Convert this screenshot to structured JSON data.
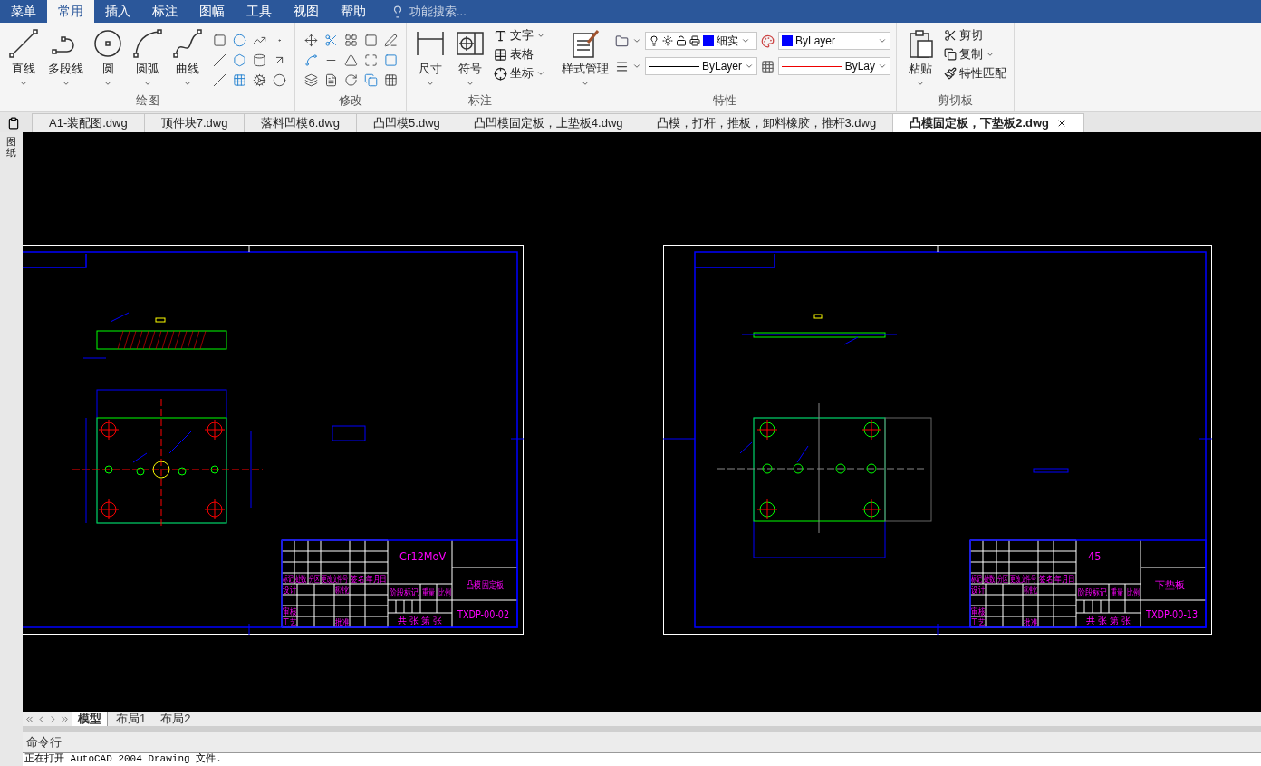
{
  "menu_tabs": [
    {
      "label": "菜单",
      "selected": false
    },
    {
      "label": "常用",
      "selected": true
    },
    {
      "label": "插入",
      "selected": false
    },
    {
      "label": "标注",
      "selected": false
    },
    {
      "label": "图幅",
      "selected": false
    },
    {
      "label": "工具",
      "selected": false
    },
    {
      "label": "视图",
      "selected": false
    },
    {
      "label": "帮助",
      "selected": false
    }
  ],
  "search": {
    "placeholder": "功能搜索..."
  },
  "ribbon": {
    "draw": {
      "title": "绘图",
      "tools": [
        "直线",
        "多段线",
        "圆",
        "圆弧",
        "曲线"
      ]
    },
    "modify": {
      "title": "修改"
    },
    "annotate": {
      "title": "标注",
      "big": [
        "尺寸",
        "符号"
      ],
      "small": [
        "文字",
        "表格",
        "坐标"
      ]
    },
    "style": {
      "label": "样式管理"
    },
    "properties": {
      "title": "特性",
      "layer": "细实",
      "color_setting": "ByLayer",
      "linetype": "ByLayer",
      "lineweight": "ByLay"
    },
    "clipboard": {
      "title": "剪切板",
      "paste": "粘贴",
      "tools": [
        "剪切",
        "复制",
        "特性匹配"
      ]
    }
  },
  "side_panel": {
    "label": "图纸"
  },
  "doc_tabs": [
    {
      "label": "A1-装配图.dwg",
      "selected": false
    },
    {
      "label": "顶件块7.dwg",
      "selected": false
    },
    {
      "label": "落料凹模6.dwg",
      "selected": false
    },
    {
      "label": "凸凹模5.dwg",
      "selected": false
    },
    {
      "label": "凸凹模固定板，上垫板4.dwg",
      "selected": false
    },
    {
      "label": "凸模，打杆，推板，卸料橡胶，推杆3.dwg",
      "selected": false
    },
    {
      "label": "凸模固定板，下垫板2.dwg",
      "selected": true
    }
  ],
  "sheets": [
    {
      "kind": "punch_plate",
      "material": "Cr12MoV",
      "part_name": "凸模固定板",
      "drawing_no": "TXDP-00-02",
      "labels": [
        "标记",
        "处数",
        "分区",
        "更改文件号",
        "签名",
        "年月日",
        "设计",
        "标准化",
        "审核",
        "工艺",
        "批准",
        "阶段标记",
        "重量",
        "比例",
        "共 张 第 张"
      ]
    },
    {
      "kind": "backing_plate",
      "material": "45",
      "part_name": "下垫板",
      "drawing_no": "TXDP-00-13",
      "labels": [
        "标记",
        "处数",
        "分区",
        "更改文件号",
        "签名",
        "年月日",
        "设计",
        "标准化",
        "审核",
        "工艺",
        "批准",
        "阶段标记",
        "重量",
        "比例",
        "共 张 第 张"
      ]
    }
  ],
  "layout_tabs": [
    {
      "label": "模型",
      "selected": true
    },
    {
      "label": "布局1",
      "selected": false
    },
    {
      "label": "布局2",
      "selected": false
    }
  ],
  "command": {
    "label": "命令行",
    "output": "正在打开 AutoCAD 2004 Drawing 文件."
  }
}
